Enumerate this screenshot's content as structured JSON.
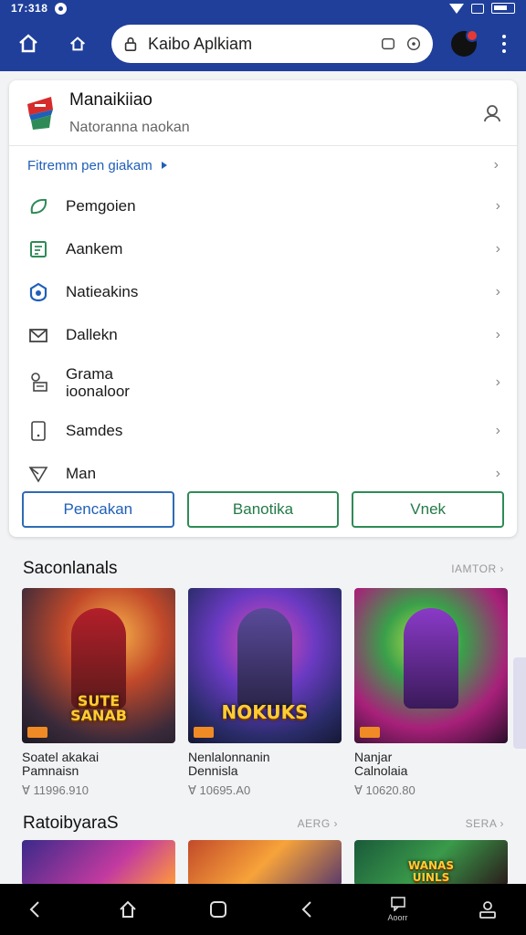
{
  "status": {
    "time": "17:318"
  },
  "browser": {
    "url": "Kaibo Aplkiam"
  },
  "app": {
    "title": "Manaikiiao",
    "subtitle": "Natoranna naokan"
  },
  "section_link": "Fitremm pen giakam",
  "menu": [
    {
      "label": "Pemgoien",
      "icon": "leaf-icon"
    },
    {
      "label": "Aankem",
      "icon": "document-icon"
    },
    {
      "label": "Natieakins",
      "icon": "shield-home-icon"
    },
    {
      "label": "Dallekn",
      "icon": "mail-icon"
    },
    {
      "label": "Grama\nioonaloor",
      "icon": "briefcase-icon"
    },
    {
      "label": "Samdes",
      "icon": "phone-icon"
    },
    {
      "label": "Man",
      "icon": "send-icon"
    }
  ],
  "buttons": {
    "left": "Pencakan",
    "middle": "Banotika",
    "right": "Vnek"
  },
  "section1": {
    "title": "Saconlanals",
    "more": "IAMTOR",
    "games": [
      {
        "logo": "SUTE\nSANAB",
        "name": "Soatel akakai\nPamnaisn",
        "meta": "Ɐ 11996.910"
      },
      {
        "logo": "NOKUKS",
        "name": "Nenlalonnanin\nDennisla",
        "meta": "Ɐ 10695.A0"
      },
      {
        "logo": "",
        "name": "Nanjar\nCalnolaia",
        "meta": "Ɐ 10620.80"
      }
    ]
  },
  "section2": {
    "title": "RatoibyaraS",
    "more_left": "AERG",
    "more_right": "SERA",
    "games": [
      {
        "logo": ""
      },
      {
        "logo": ""
      },
      {
        "logo": "WANAS\nUINLS"
      }
    ]
  },
  "navbar": {
    "app_caption": "Aoorr"
  },
  "colors": {
    "brand": "#1f3f9a",
    "link": "#1f5fb8",
    "green": "#2e8b57"
  }
}
